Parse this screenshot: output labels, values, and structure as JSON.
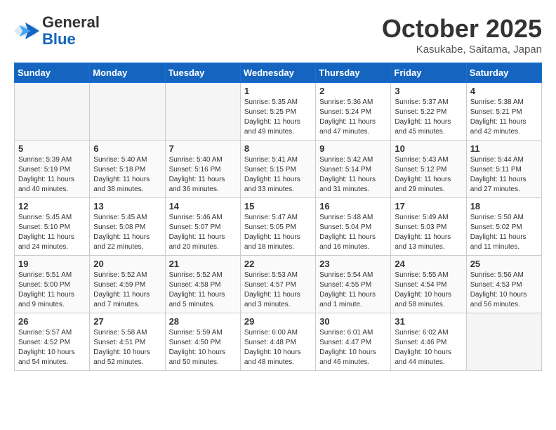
{
  "header": {
    "logo_line1": "General",
    "logo_line2": "Blue",
    "month": "October 2025",
    "location": "Kasukabe, Saitama, Japan"
  },
  "weekdays": [
    "Sunday",
    "Monday",
    "Tuesday",
    "Wednesday",
    "Thursday",
    "Friday",
    "Saturday"
  ],
  "weeks": [
    [
      {
        "day": "",
        "info": ""
      },
      {
        "day": "",
        "info": ""
      },
      {
        "day": "",
        "info": ""
      },
      {
        "day": "1",
        "info": "Sunrise: 5:35 AM\nSunset: 5:25 PM\nDaylight: 11 hours\nand 49 minutes."
      },
      {
        "day": "2",
        "info": "Sunrise: 5:36 AM\nSunset: 5:24 PM\nDaylight: 11 hours\nand 47 minutes."
      },
      {
        "day": "3",
        "info": "Sunrise: 5:37 AM\nSunset: 5:22 PM\nDaylight: 11 hours\nand 45 minutes."
      },
      {
        "day": "4",
        "info": "Sunrise: 5:38 AM\nSunset: 5:21 PM\nDaylight: 11 hours\nand 42 minutes."
      }
    ],
    [
      {
        "day": "5",
        "info": "Sunrise: 5:39 AM\nSunset: 5:19 PM\nDaylight: 11 hours\nand 40 minutes."
      },
      {
        "day": "6",
        "info": "Sunrise: 5:40 AM\nSunset: 5:18 PM\nDaylight: 11 hours\nand 38 minutes."
      },
      {
        "day": "7",
        "info": "Sunrise: 5:40 AM\nSunset: 5:16 PM\nDaylight: 11 hours\nand 36 minutes."
      },
      {
        "day": "8",
        "info": "Sunrise: 5:41 AM\nSunset: 5:15 PM\nDaylight: 11 hours\nand 33 minutes."
      },
      {
        "day": "9",
        "info": "Sunrise: 5:42 AM\nSunset: 5:14 PM\nDaylight: 11 hours\nand 31 minutes."
      },
      {
        "day": "10",
        "info": "Sunrise: 5:43 AM\nSunset: 5:12 PM\nDaylight: 11 hours\nand 29 minutes."
      },
      {
        "day": "11",
        "info": "Sunrise: 5:44 AM\nSunset: 5:11 PM\nDaylight: 11 hours\nand 27 minutes."
      }
    ],
    [
      {
        "day": "12",
        "info": "Sunrise: 5:45 AM\nSunset: 5:10 PM\nDaylight: 11 hours\nand 24 minutes."
      },
      {
        "day": "13",
        "info": "Sunrise: 5:45 AM\nSunset: 5:08 PM\nDaylight: 11 hours\nand 22 minutes."
      },
      {
        "day": "14",
        "info": "Sunrise: 5:46 AM\nSunset: 5:07 PM\nDaylight: 11 hours\nand 20 minutes."
      },
      {
        "day": "15",
        "info": "Sunrise: 5:47 AM\nSunset: 5:05 PM\nDaylight: 11 hours\nand 18 minutes."
      },
      {
        "day": "16",
        "info": "Sunrise: 5:48 AM\nSunset: 5:04 PM\nDaylight: 11 hours\nand 16 minutes."
      },
      {
        "day": "17",
        "info": "Sunrise: 5:49 AM\nSunset: 5:03 PM\nDaylight: 11 hours\nand 13 minutes."
      },
      {
        "day": "18",
        "info": "Sunrise: 5:50 AM\nSunset: 5:02 PM\nDaylight: 11 hours\nand 11 minutes."
      }
    ],
    [
      {
        "day": "19",
        "info": "Sunrise: 5:51 AM\nSunset: 5:00 PM\nDaylight: 11 hours\nand 9 minutes."
      },
      {
        "day": "20",
        "info": "Sunrise: 5:52 AM\nSunset: 4:59 PM\nDaylight: 11 hours\nand 7 minutes."
      },
      {
        "day": "21",
        "info": "Sunrise: 5:52 AM\nSunset: 4:58 PM\nDaylight: 11 hours\nand 5 minutes."
      },
      {
        "day": "22",
        "info": "Sunrise: 5:53 AM\nSunset: 4:57 PM\nDaylight: 11 hours\nand 3 minutes."
      },
      {
        "day": "23",
        "info": "Sunrise: 5:54 AM\nSunset: 4:55 PM\nDaylight: 11 hours\nand 1 minute."
      },
      {
        "day": "24",
        "info": "Sunrise: 5:55 AM\nSunset: 4:54 PM\nDaylight: 10 hours\nand 58 minutes."
      },
      {
        "day": "25",
        "info": "Sunrise: 5:56 AM\nSunset: 4:53 PM\nDaylight: 10 hours\nand 56 minutes."
      }
    ],
    [
      {
        "day": "26",
        "info": "Sunrise: 5:57 AM\nSunset: 4:52 PM\nDaylight: 10 hours\nand 54 minutes."
      },
      {
        "day": "27",
        "info": "Sunrise: 5:58 AM\nSunset: 4:51 PM\nDaylight: 10 hours\nand 52 minutes."
      },
      {
        "day": "28",
        "info": "Sunrise: 5:59 AM\nSunset: 4:50 PM\nDaylight: 10 hours\nand 50 minutes."
      },
      {
        "day": "29",
        "info": "Sunrise: 6:00 AM\nSunset: 4:48 PM\nDaylight: 10 hours\nand 48 minutes."
      },
      {
        "day": "30",
        "info": "Sunrise: 6:01 AM\nSunset: 4:47 PM\nDaylight: 10 hours\nand 46 minutes."
      },
      {
        "day": "31",
        "info": "Sunrise: 6:02 AM\nSunset: 4:46 PM\nDaylight: 10 hours\nand 44 minutes."
      },
      {
        "day": "",
        "info": ""
      }
    ]
  ]
}
